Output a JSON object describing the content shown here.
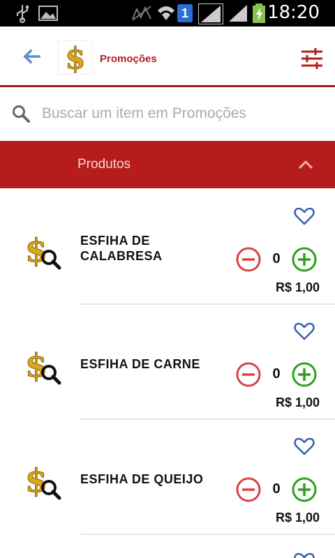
{
  "status_bar": {
    "time": "18:20",
    "sim_label": "1"
  },
  "header": {
    "title": "Promoções"
  },
  "search": {
    "placeholder": "Buscar um item em Promoções"
  },
  "section": {
    "title": "Produtos"
  },
  "products": [
    {
      "name": "ESFIHA DE CALABRESA",
      "quantity": "0",
      "price": "R$ 1,00"
    },
    {
      "name": "ESFIHA DE CARNE",
      "quantity": "0",
      "price": "R$ 1,00"
    },
    {
      "name": "ESFIHA DE QUEIJO",
      "quantity": "0",
      "price": "R$ 1,00"
    }
  ],
  "colors": {
    "brand_red": "#b71c1c",
    "back_arrow": "#5b8fd1",
    "heart_blue": "#3a62b0",
    "minus_red": "#d84343",
    "plus_green": "#2ca01c",
    "logo_gold": "#d8a91a"
  },
  "icons": {
    "back": "arrow-left-icon",
    "logo": "dollar-sign-icon",
    "filter": "sliders-icon",
    "search": "search-icon",
    "collapse": "chevron-up-icon",
    "favorite": "heart-outline-icon",
    "decrease": "minus-circle-icon",
    "increase": "plus-circle-icon",
    "product_thumb": "dollar-magnifier-icon"
  }
}
